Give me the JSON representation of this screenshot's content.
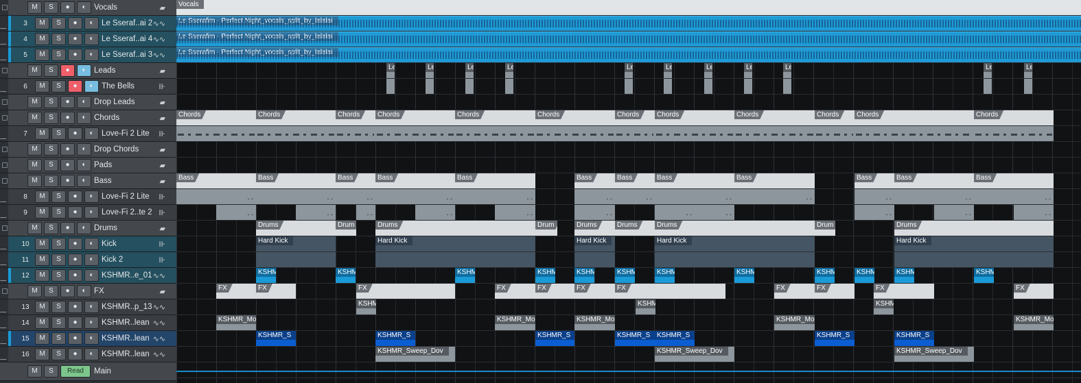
{
  "colors": {
    "vocal": "#1f9ad5",
    "accent_blue": "#1a9bd8",
    "rec": "#ef5f6a",
    "monitor": "#77bde0",
    "read": "#7cc68c"
  },
  "tracks": [
    {
      "id": "vocals",
      "num": "",
      "name": "Vocals",
      "type": "folder",
      "icon": "folder-icon",
      "m": "M",
      "s": "S",
      "rec": "●",
      "mon": "◐"
    },
    {
      "id": "t3",
      "num": "3",
      "name": "Le Sseraf..ai 2",
      "type": "audio",
      "icon": "waveform-icon",
      "m": "M",
      "s": "S",
      "rec": "●",
      "mon": "◐"
    },
    {
      "id": "t4",
      "num": "4",
      "name": "Le Sseraf..ai 4",
      "type": "audio",
      "icon": "waveform-icon",
      "m": "M",
      "s": "S",
      "rec": "●",
      "mon": "◐"
    },
    {
      "id": "t5",
      "num": "5",
      "name": "Le Sseraf..ai 3",
      "type": "audio",
      "icon": "waveform-icon",
      "m": "M",
      "s": "S",
      "rec": "●",
      "mon": "◐"
    },
    {
      "id": "leads",
      "num": "",
      "name": "Leads",
      "type": "folder",
      "icon": "folder-icon",
      "m": "M",
      "s": "S",
      "rec": "●",
      "mon": "◐"
    },
    {
      "id": "t6",
      "num": "6",
      "name": "The Bells",
      "type": "instrument",
      "icon": "keyboard-icon",
      "m": "M",
      "s": "S",
      "rec": "●",
      "mon": "◐"
    },
    {
      "id": "dropleads",
      "num": "",
      "name": "Drop Leads",
      "type": "folder",
      "icon": "folder-icon",
      "m": "M",
      "s": "S",
      "rec": "●",
      "mon": "◐"
    },
    {
      "id": "chords",
      "num": "",
      "name": "Chords",
      "type": "folder",
      "icon": "folder-icon",
      "m": "M",
      "s": "S",
      "rec": "●",
      "mon": "◐"
    },
    {
      "id": "t7",
      "num": "7",
      "name": "Love-Fi 2 Lite",
      "type": "instrument",
      "icon": "keyboard-icon",
      "m": "M",
      "s": "S",
      "rec": "●",
      "mon": "◐"
    },
    {
      "id": "dropchords",
      "num": "",
      "name": "Drop Chords",
      "type": "folder",
      "icon": "folder-icon",
      "m": "M",
      "s": "S",
      "rec": "●",
      "mon": "◐"
    },
    {
      "id": "pads",
      "num": "",
      "name": "Pads",
      "type": "folder",
      "icon": "folder-icon",
      "m": "M",
      "s": "S",
      "rec": "●",
      "mon": "◐"
    },
    {
      "id": "bass",
      "num": "",
      "name": "Bass",
      "type": "folder",
      "icon": "folder-icon",
      "m": "M",
      "s": "S",
      "rec": "●",
      "mon": "◐"
    },
    {
      "id": "t8",
      "num": "8",
      "name": "Love-Fi 2 Lite",
      "type": "instrument",
      "icon": "keyboard-icon",
      "m": "M",
      "s": "S",
      "rec": "●",
      "mon": "◐"
    },
    {
      "id": "t9",
      "num": "9",
      "name": "Love-Fi 2..te 2",
      "type": "instrument",
      "icon": "keyboard-icon",
      "m": "M",
      "s": "S",
      "rec": "●",
      "mon": "◐"
    },
    {
      "id": "drums",
      "num": "",
      "name": "Drums",
      "type": "folder",
      "icon": "folder-icon",
      "m": "M",
      "s": "S",
      "rec": "●",
      "mon": "◐"
    },
    {
      "id": "t10",
      "num": "10",
      "name": "Kick",
      "type": "instrument",
      "icon": "keyboard-icon",
      "m": "M",
      "s": "S",
      "rec": "●",
      "mon": "◐"
    },
    {
      "id": "t11",
      "num": "11",
      "name": "Kick 2",
      "type": "instrument",
      "icon": "keyboard-icon",
      "m": "M",
      "s": "S",
      "rec": "●",
      "mon": "◐"
    },
    {
      "id": "t12",
      "num": "12",
      "name": "KSHMR..e_01",
      "type": "audio",
      "icon": "waveform-icon",
      "m": "M",
      "s": "S",
      "rec": "●",
      "mon": "◐"
    },
    {
      "id": "fx",
      "num": "",
      "name": "FX",
      "type": "folder",
      "icon": "folder-icon",
      "m": "M",
      "s": "S",
      "rec": "●",
      "mon": "◐"
    },
    {
      "id": "t13",
      "num": "13",
      "name": "KSHMR..p_13",
      "type": "audio",
      "icon": "waveform-icon",
      "m": "M",
      "s": "S",
      "rec": "●",
      "mon": "◐"
    },
    {
      "id": "t14",
      "num": "14",
      "name": "KSHMR..lean",
      "type": "audio",
      "icon": "waveform-icon",
      "m": "M",
      "s": "S",
      "rec": "●",
      "mon": "◐"
    },
    {
      "id": "t15",
      "num": "15",
      "name": "KSHMR..lean",
      "type": "audio",
      "icon": "waveform-icon",
      "m": "M",
      "s": "S",
      "rec": "●",
      "mon": "◐"
    },
    {
      "id": "t16",
      "num": "16",
      "name": "KSHMR..lean",
      "type": "audio",
      "icon": "waveform-icon",
      "m": "M",
      "s": "S",
      "rec": "●",
      "mon": "◐"
    }
  ],
  "main": {
    "m": "M",
    "s": "S",
    "automation": "Read",
    "name": "Main"
  },
  "clips": {
    "vocals_folder": "Vocals",
    "vocal_clip": "Le Sserafim - Perfect Night_vocals_split_by_lalalai",
    "leads_short": "Le",
    "chords": "Chords",
    "bass": "Bass",
    "drums": "Drums",
    "drums_trunc": "Drum",
    "drums_trunc2": "Drums",
    "hard_kick": "Hard Kick",
    "kshmr": "KSHM",
    "kshmr_t12": "KSHMR",
    "fx": "FX",
    "kshmr13": "KSHM",
    "kshmr_mo": "KSHMR_Mo",
    "kshmr_s": "KSHMR_S",
    "kshmr_sweep": "KSHMR_Sweep_Dov",
    "dashes": "- -"
  }
}
